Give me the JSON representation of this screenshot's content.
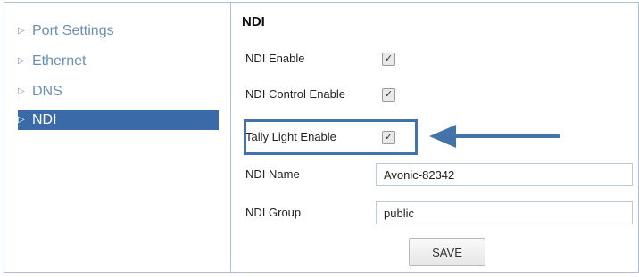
{
  "sidebar": {
    "items": [
      {
        "label": "Port Settings"
      },
      {
        "label": "Ethernet"
      },
      {
        "label": "DNS"
      },
      {
        "label": "NDI",
        "active": true
      }
    ],
    "triangle_glyph": "▷"
  },
  "main": {
    "title": "NDI",
    "ndi_enable": {
      "label": "NDI Enable",
      "checked": true
    },
    "ndi_control_enable": {
      "label": "NDI Control Enable",
      "checked": true
    },
    "tally_light_enable": {
      "label": "Tally Light Enable",
      "checked": true
    },
    "ndi_name": {
      "label": "NDI Name",
      "value": "Avonic-82342"
    },
    "ndi_group": {
      "label": "NDI Group",
      "value": "public"
    },
    "save_label": "SAVE"
  },
  "annotation": {
    "color": "#4373a8",
    "arrow_icon": "left-arrow-icon"
  },
  "colors": {
    "active_nav": "#3a6aa8",
    "nav_text": "#6b8fb3",
    "border": "#a9c0d8"
  }
}
